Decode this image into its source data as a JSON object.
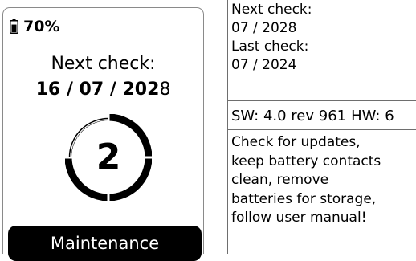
{
  "device": {
    "battery_percent_label": "70%",
    "battery_level": 0.7,
    "next_check_label": "Next check:",
    "next_check_date_prefix": "16 / 07 / 202",
    "next_check_date_suffix": "8",
    "remaining_count": "2",
    "status_label": "Maintenance",
    "icons": {
      "battery": "battery-icon",
      "progress_ring": "progress-ring-icon"
    }
  },
  "info_panel": {
    "next_check_label": "Next check:",
    "next_check_value": "07 / 2028",
    "last_check_label": "Last check:",
    "last_check_value": "07 / 2024",
    "software_version": "SW: 4.0 rev 961",
    "hardware_version": "HW: 6",
    "advice_lines": [
      "Check for updates,",
      "keep battery contacts",
      "clean, remove",
      "batteries for storage,",
      "follow user manual!"
    ]
  },
  "colors": {
    "background": "#ffffff",
    "foreground": "#000000",
    "border": "#8a8a8a"
  }
}
